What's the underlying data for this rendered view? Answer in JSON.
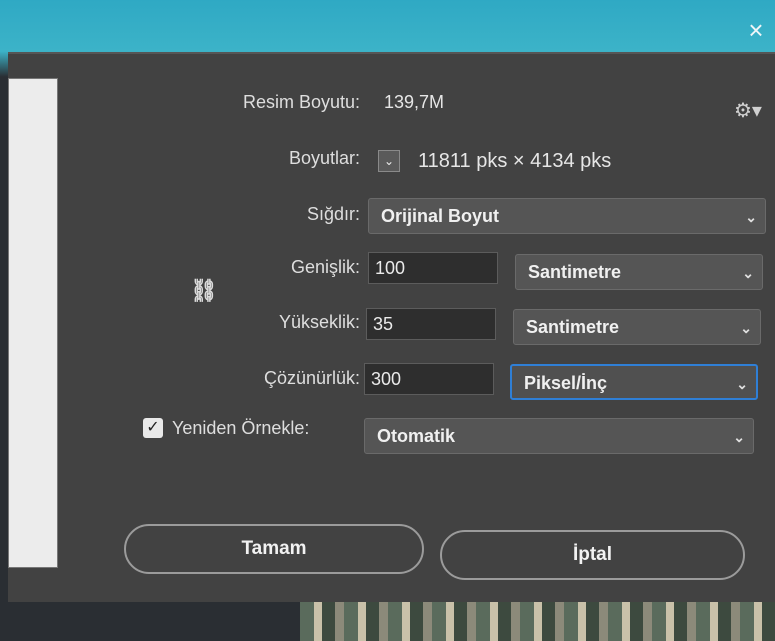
{
  "dialog": {
    "image_size_label": "Resim Boyutu:",
    "image_size_value": "139,7M",
    "dimensions_label": "Boyutlar:",
    "dimensions_value": "11811 pks  ×  4134 pks",
    "fit_label": "Sığdır:",
    "fit_value": "Orijinal Boyut",
    "width_label": "Genişlik:",
    "width_value": "100",
    "width_unit": "Santimetre",
    "height_label": "Yükseklik:",
    "height_value": "35",
    "height_unit": "Santimetre",
    "resolution_label": "Çözünürlük:",
    "resolution_value": "300",
    "resolution_unit": "Piksel/İnç",
    "resample_label": "Yeniden Örnekle:",
    "resample_checked": true,
    "resample_value": "Otomatik",
    "ok_label": "Tamam",
    "cancel_label": "İptal",
    "close_glyph": "×"
  },
  "icons": {
    "gear": "gear-icon",
    "link": "link-chain-icon",
    "chevron": "chevron-down-icon",
    "close": "close-icon"
  },
  "colors": {
    "dialog_bg": "#424242",
    "focus_border": "#2f7fd6"
  }
}
